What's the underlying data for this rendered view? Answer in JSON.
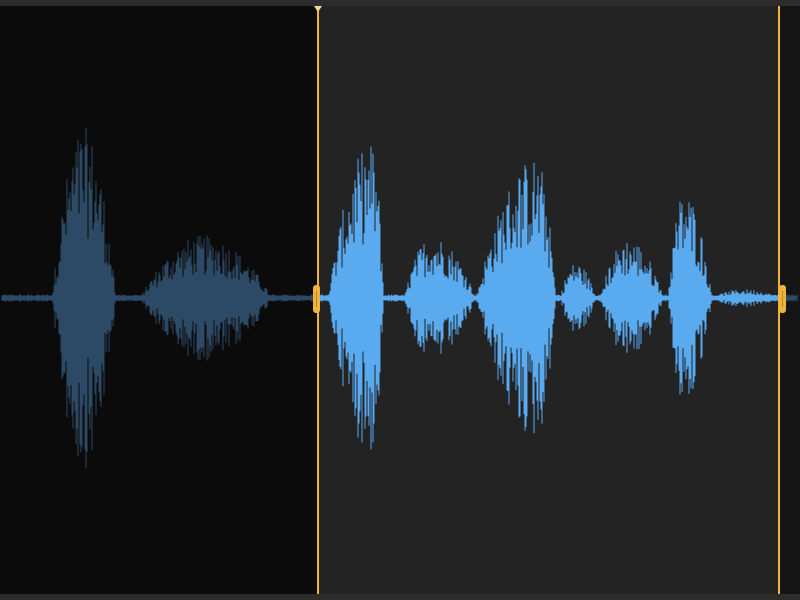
{
  "app": {
    "view": "audio-trim-editor"
  },
  "colors": {
    "background": "#0b0b0b",
    "selection_background": "#232323",
    "waveform_selected": "#5aaaf0",
    "waveform_unselected": "#2c4a66",
    "trim_accent": "#f0b43c",
    "bar": "#2c2c2c"
  },
  "icons": {
    "playhead": "playhead-triangle-icon",
    "trim_start": "trim-start-handle-icon",
    "trim_end": "trim-end-handle-icon"
  },
  "waveform": {
    "bursts": [
      {
        "start": 0.065,
        "end": 0.145,
        "peak": 0.57,
        "center": 0.105
      },
      {
        "start": 0.175,
        "end": 0.34,
        "peak": 0.21,
        "center": 0.255
      },
      {
        "start": 0.41,
        "end": 0.48,
        "peak": 0.52,
        "center": 0.465
      },
      {
        "start": 0.505,
        "end": 0.595,
        "peak": 0.21,
        "center": 0.54
      },
      {
        "start": 0.595,
        "end": 0.695,
        "peak": 0.47,
        "center": 0.67
      },
      {
        "start": 0.7,
        "end": 0.745,
        "peak": 0.12,
        "center": 0.72
      },
      {
        "start": 0.75,
        "end": 0.83,
        "peak": 0.2,
        "center": 0.785
      },
      {
        "start": 0.835,
        "end": 0.89,
        "peak": 0.36,
        "center": 0.855
      },
      {
        "start": 0.89,
        "end": 0.975,
        "peak": 0.03,
        "center": 0.93
      }
    ]
  }
}
